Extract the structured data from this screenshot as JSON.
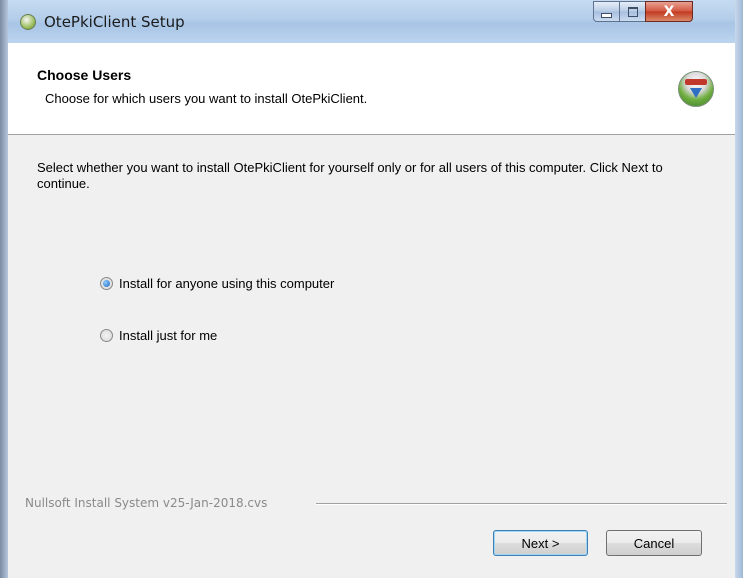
{
  "window": {
    "title": "OtePkiClient Setup",
    "icon": "installer-icon",
    "controls": {
      "minimize": "minimize",
      "maximize": "maximize",
      "close": "X"
    }
  },
  "header": {
    "title": "Choose Users",
    "subtitle": "Choose for which users you want to install OtePkiClient.",
    "logo": "nsis-installer-logo"
  },
  "body": {
    "intro": "Select whether you want to install OtePkiClient for yourself only or for all users of this computer. Click Next to continue.",
    "options": [
      {
        "label": "Install for anyone using this computer",
        "selected": true
      },
      {
        "label": "Install just for me",
        "selected": false
      }
    ]
  },
  "footer": {
    "brand": "Nullsoft Install System v25-Jan-2018.cvs",
    "next_label": "Next >",
    "cancel_label": "Cancel"
  },
  "colors": {
    "titlebar": "#b3cde9",
    "client_bg": "#f0f0f0",
    "close_button": "#c3381f",
    "radio_selected": "#1d5fbf"
  }
}
